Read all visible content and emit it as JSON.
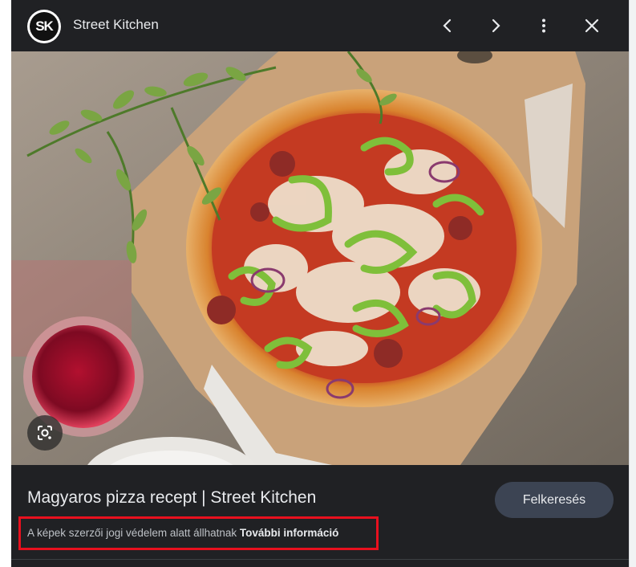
{
  "header": {
    "logo_text": "SK",
    "site_name": "Street Kitchen"
  },
  "icons": {
    "previous": "chevron-left-icon",
    "next": "chevron-right-icon",
    "more": "more-vertical-icon",
    "close": "close-icon",
    "lens": "google-lens-icon"
  },
  "result": {
    "title": "Magyaros pizza recept | Street Kitchen",
    "visit_label": "Felkeresés",
    "copyright_text": "A képek szerzői jogi védelem alatt állhatnak",
    "more_info_label": "További információ"
  },
  "colors": {
    "panel_bg": "#202124",
    "button_bg": "#3c4453",
    "highlight": "#e8101e"
  }
}
